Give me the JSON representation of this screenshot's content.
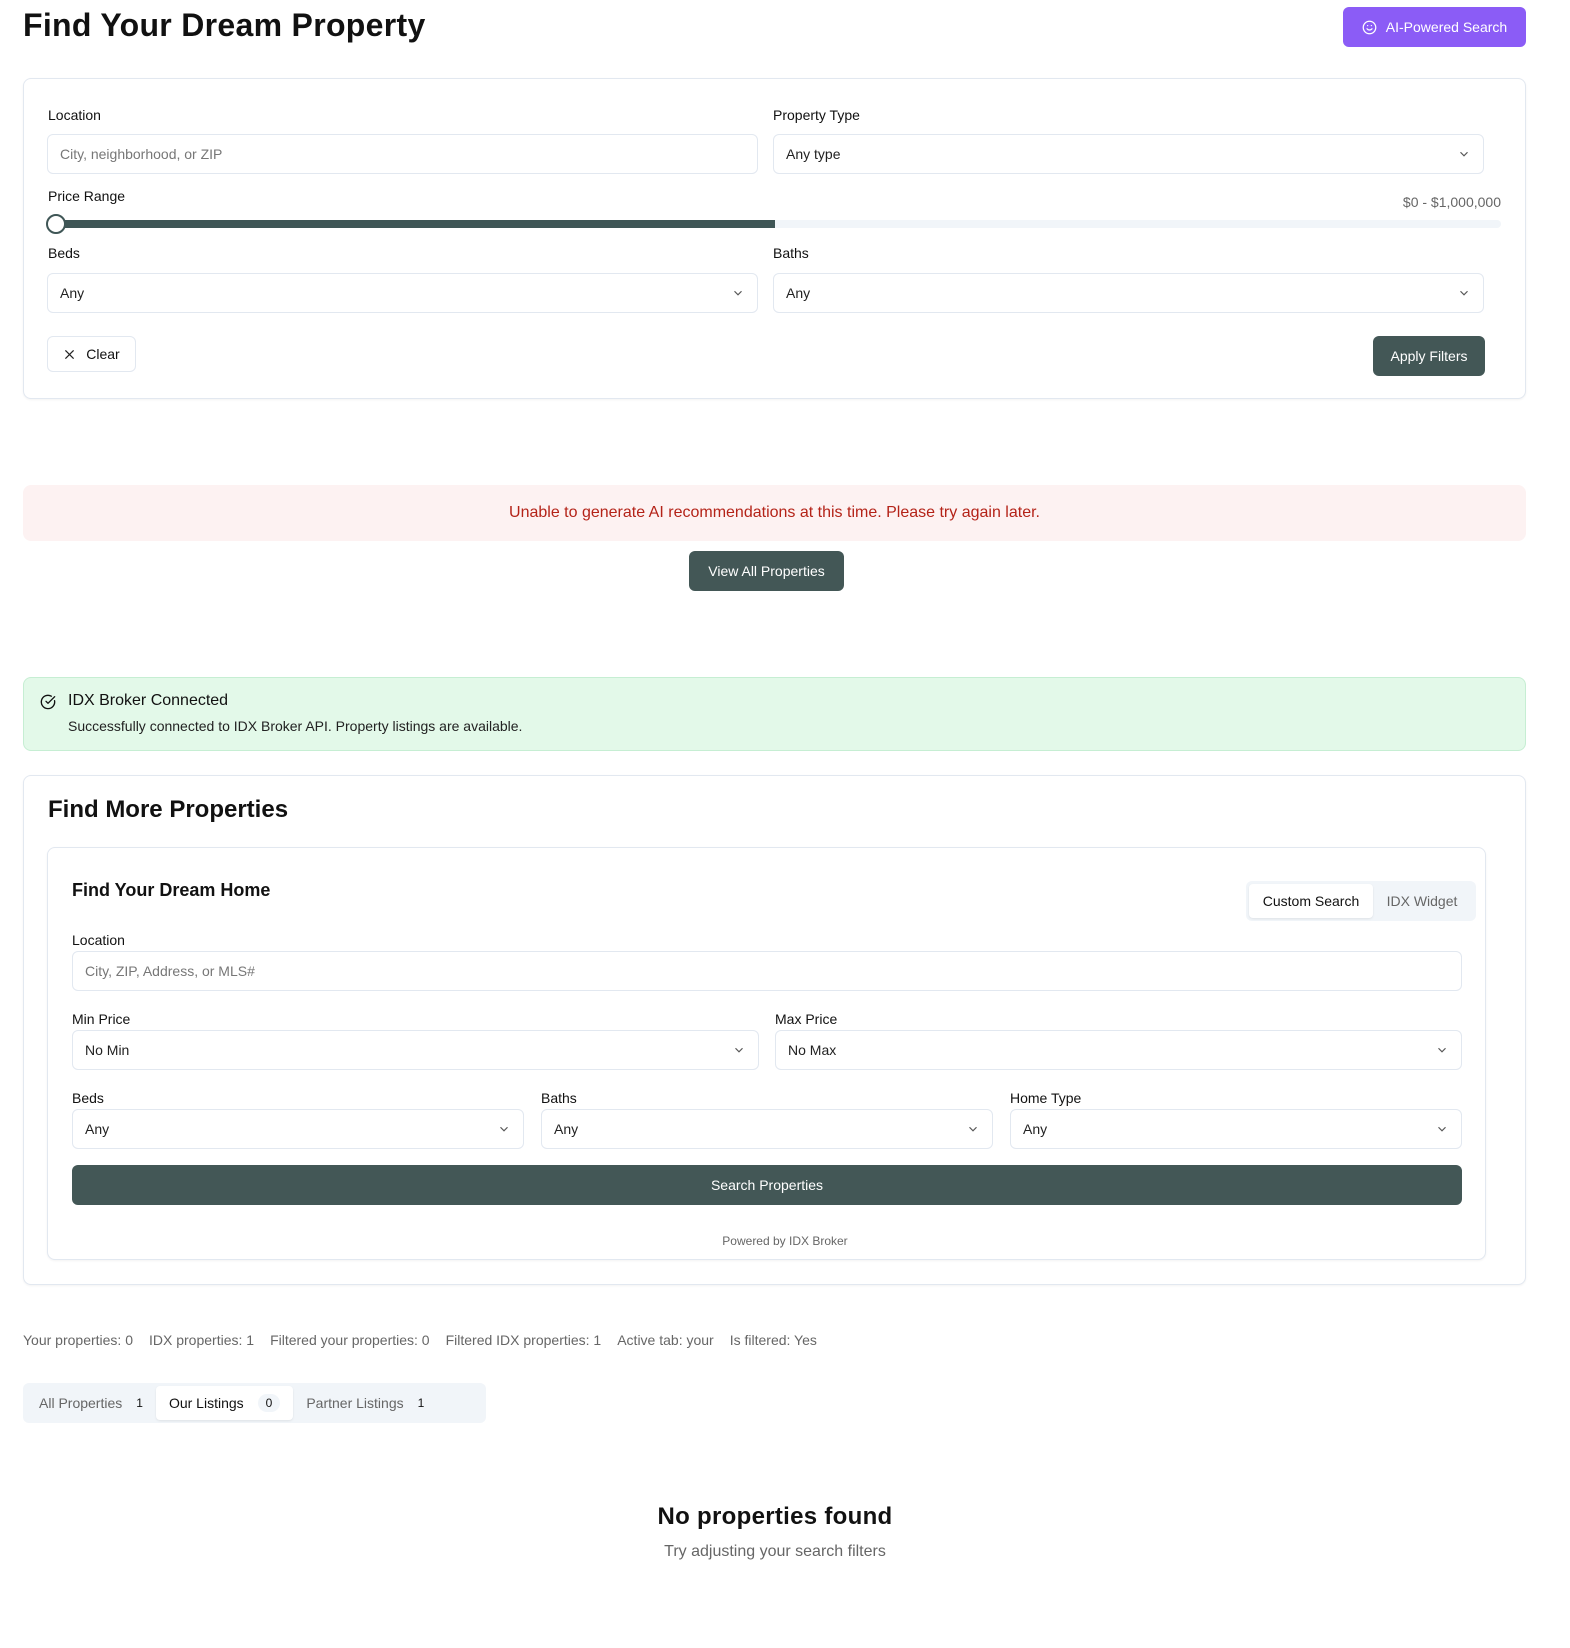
{
  "header": {
    "title": "Find Your Dream Property",
    "ai_button": "AI-Powered Search"
  },
  "filters": {
    "location_label": "Location",
    "location_placeholder": "City, neighborhood, or ZIP",
    "property_type_label": "Property Type",
    "property_type_value": "Any type",
    "price_range_label": "Price Range",
    "price_range_text": "$0 - $1,000,000",
    "price_range_fill_fraction": 0.5,
    "beds_label": "Beds",
    "beds_value": "Any",
    "baths_label": "Baths",
    "baths_value": "Any",
    "clear_button": "Clear",
    "apply_button": "Apply Filters"
  },
  "ai_error": {
    "message": "Unable to generate AI recommendations at this time. Please try again later.",
    "view_all_button": "View All Properties"
  },
  "idx_status": {
    "title": "IDX Broker Connected",
    "description": "Successfully connected to IDX Broker API. Property listings are available."
  },
  "find_more": {
    "title": "Find More Properties",
    "subtitle": "Find Your Dream Home",
    "tabs": [
      "Custom Search",
      "IDX Widget"
    ],
    "active_tab": "Custom Search",
    "location_label": "Location",
    "location_placeholder": "City, ZIP, Address, or MLS#",
    "min_price_label": "Min Price",
    "min_price_value": "No Min",
    "max_price_label": "Max Price",
    "max_price_value": "No Max",
    "beds_label": "Beds",
    "beds_value": "Any",
    "baths_label": "Baths",
    "baths_value": "Any",
    "home_type_label": "Home Type",
    "home_type_value": "Any",
    "search_button": "Search Properties",
    "powered_by": "Powered by IDX Broker"
  },
  "stats": [
    "Your properties: 0",
    "IDX properties: 1",
    "Filtered your properties: 0",
    "Filtered IDX properties: 1",
    "Active tab: your",
    "Is filtered: Yes"
  ],
  "listing_tabs": [
    {
      "label": "All Properties",
      "count": "1"
    },
    {
      "label": "Our Listings",
      "count": "0"
    },
    {
      "label": "Partner Listings",
      "count": "1"
    }
  ],
  "empty_state": {
    "title": "No properties found",
    "subtitle": "Try adjusting your search filters"
  },
  "colors": {
    "accent_purple": "#8b5cf6",
    "primary_dark": "#435756",
    "error_bg": "#fdf2f2",
    "error_text": "#b42318",
    "success_bg": "#e3f9e9"
  }
}
